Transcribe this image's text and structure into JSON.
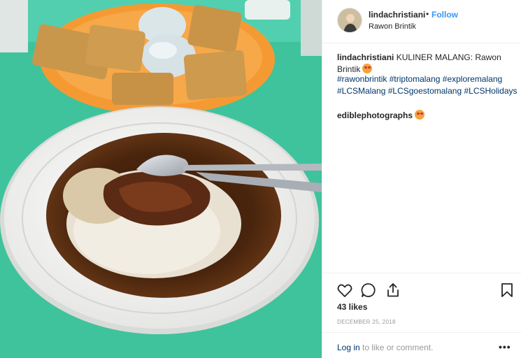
{
  "post": {
    "username": "lindachristiani",
    "separator": "•",
    "follow_label": "Follow",
    "location": "Rawon Brintik",
    "caption_user": "lindachristiani",
    "caption_text": " KULINER MALANG: Rawon Brintik",
    "hashtags": [
      "#rawonbrintik",
      "#triptomalang",
      "#exploremalang",
      "#LCSMalang",
      "#LCSgoestomalang",
      "#LCSHolidays"
    ],
    "comment_user": "ediblephotographs",
    "likes": "43 likes",
    "date": "DECEMBER 25, 2018",
    "login_link": "Log in",
    "login_text": " to like or comment.",
    "more_label": "•••"
  },
  "icons": {
    "like": "heart-icon",
    "comment": "speech-bubble-icon",
    "share": "share-upload-icon",
    "save": "bookmark-icon",
    "emoji": "heart-eyes-emoji-icon"
  },
  "colors": {
    "link": "#3897f0",
    "hashtag": "#003569",
    "muted": "#999999",
    "table": "#3fc39c",
    "plate": "#f59a33"
  }
}
